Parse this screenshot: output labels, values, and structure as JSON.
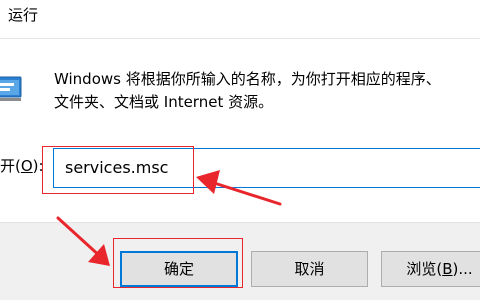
{
  "window": {
    "title": "运行"
  },
  "description": {
    "line1": "Windows 将根据你所输入的名称，为你打开相应的程序、",
    "line2": "文件夹、文档或 Internet 资源。"
  },
  "open": {
    "label_prefix": "开(",
    "label_key": "O",
    "label_suffix": "):",
    "value": "services.msc"
  },
  "buttons": {
    "ok": "确定",
    "cancel": "取消",
    "browse_prefix": "浏览(",
    "browse_key": "B",
    "browse_suffix": ")..."
  },
  "colors": {
    "highlight": "#e8262b",
    "focus": "#0078d7",
    "footer_bg": "#f0f0f0"
  },
  "icons": {
    "run": "run-dialog-icon",
    "dropdown": "chevron-down-icon"
  }
}
